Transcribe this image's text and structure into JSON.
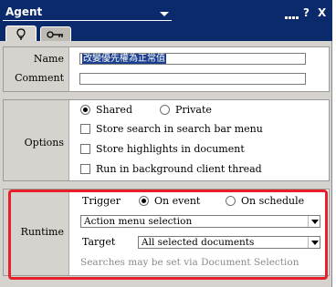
{
  "window": {
    "title": "Agent"
  },
  "titlebar": {
    "help_label": "?",
    "close_label": "X"
  },
  "tabs": [
    {
      "icon": "lightbulb-icon"
    },
    {
      "icon": "key-icon"
    }
  ],
  "general": {
    "name_label": "Name",
    "name_value": "改變優先權為正常值",
    "comment_label": "Comment",
    "comment_value": ""
  },
  "options": {
    "label": "Options",
    "shared_label": "Shared",
    "private_label": "Private",
    "selected": "Shared",
    "store_search_label": "Store search in search bar menu",
    "store_highlights_label": "Store highlights in document",
    "run_background_label": "Run in background client thread"
  },
  "runtime": {
    "label": "Runtime",
    "trigger_label": "Trigger",
    "on_event_label": "On event",
    "on_schedule_label": "On schedule",
    "trigger_selected": "On event",
    "event_value": "Action menu selection",
    "target_label": "Target",
    "target_value": "All selected documents",
    "hint": "Searches may be set via Document Selection"
  },
  "colors": {
    "titlebar": "#0a2a6b",
    "panel": "#d6d3ce",
    "annotation": "#e5202a"
  }
}
